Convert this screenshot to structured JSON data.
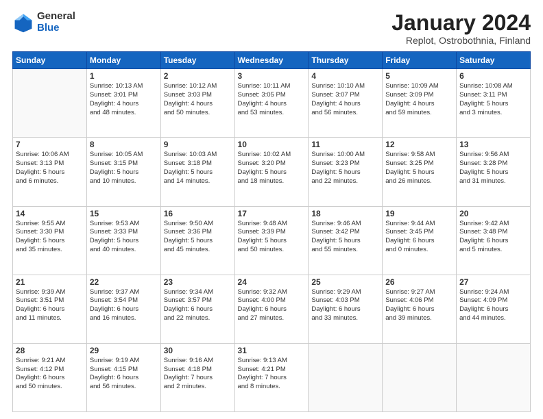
{
  "logo": {
    "general": "General",
    "blue": "Blue"
  },
  "title": "January 2024",
  "subtitle": "Replot, Ostrobothnia, Finland",
  "weekdays": [
    "Sunday",
    "Monday",
    "Tuesday",
    "Wednesday",
    "Thursday",
    "Friday",
    "Saturday"
  ],
  "weeks": [
    [
      {
        "day": "",
        "detail": ""
      },
      {
        "day": "1",
        "detail": "Sunrise: 10:13 AM\nSunset: 3:01 PM\nDaylight: 4 hours\nand 48 minutes."
      },
      {
        "day": "2",
        "detail": "Sunrise: 10:12 AM\nSunset: 3:03 PM\nDaylight: 4 hours\nand 50 minutes."
      },
      {
        "day": "3",
        "detail": "Sunrise: 10:11 AM\nSunset: 3:05 PM\nDaylight: 4 hours\nand 53 minutes."
      },
      {
        "day": "4",
        "detail": "Sunrise: 10:10 AM\nSunset: 3:07 PM\nDaylight: 4 hours\nand 56 minutes."
      },
      {
        "day": "5",
        "detail": "Sunrise: 10:09 AM\nSunset: 3:09 PM\nDaylight: 4 hours\nand 59 minutes."
      },
      {
        "day": "6",
        "detail": "Sunrise: 10:08 AM\nSunset: 3:11 PM\nDaylight: 5 hours\nand 3 minutes."
      }
    ],
    [
      {
        "day": "7",
        "detail": "Sunrise: 10:06 AM\nSunset: 3:13 PM\nDaylight: 5 hours\nand 6 minutes."
      },
      {
        "day": "8",
        "detail": "Sunrise: 10:05 AM\nSunset: 3:15 PM\nDaylight: 5 hours\nand 10 minutes."
      },
      {
        "day": "9",
        "detail": "Sunrise: 10:03 AM\nSunset: 3:18 PM\nDaylight: 5 hours\nand 14 minutes."
      },
      {
        "day": "10",
        "detail": "Sunrise: 10:02 AM\nSunset: 3:20 PM\nDaylight: 5 hours\nand 18 minutes."
      },
      {
        "day": "11",
        "detail": "Sunrise: 10:00 AM\nSunset: 3:23 PM\nDaylight: 5 hours\nand 22 minutes."
      },
      {
        "day": "12",
        "detail": "Sunrise: 9:58 AM\nSunset: 3:25 PM\nDaylight: 5 hours\nand 26 minutes."
      },
      {
        "day": "13",
        "detail": "Sunrise: 9:56 AM\nSunset: 3:28 PM\nDaylight: 5 hours\nand 31 minutes."
      }
    ],
    [
      {
        "day": "14",
        "detail": "Sunrise: 9:55 AM\nSunset: 3:30 PM\nDaylight: 5 hours\nand 35 minutes."
      },
      {
        "day": "15",
        "detail": "Sunrise: 9:53 AM\nSunset: 3:33 PM\nDaylight: 5 hours\nand 40 minutes."
      },
      {
        "day": "16",
        "detail": "Sunrise: 9:50 AM\nSunset: 3:36 PM\nDaylight: 5 hours\nand 45 minutes."
      },
      {
        "day": "17",
        "detail": "Sunrise: 9:48 AM\nSunset: 3:39 PM\nDaylight: 5 hours\nand 50 minutes."
      },
      {
        "day": "18",
        "detail": "Sunrise: 9:46 AM\nSunset: 3:42 PM\nDaylight: 5 hours\nand 55 minutes."
      },
      {
        "day": "19",
        "detail": "Sunrise: 9:44 AM\nSunset: 3:45 PM\nDaylight: 6 hours\nand 0 minutes."
      },
      {
        "day": "20",
        "detail": "Sunrise: 9:42 AM\nSunset: 3:48 PM\nDaylight: 6 hours\nand 5 minutes."
      }
    ],
    [
      {
        "day": "21",
        "detail": "Sunrise: 9:39 AM\nSunset: 3:51 PM\nDaylight: 6 hours\nand 11 minutes."
      },
      {
        "day": "22",
        "detail": "Sunrise: 9:37 AM\nSunset: 3:54 PM\nDaylight: 6 hours\nand 16 minutes."
      },
      {
        "day": "23",
        "detail": "Sunrise: 9:34 AM\nSunset: 3:57 PM\nDaylight: 6 hours\nand 22 minutes."
      },
      {
        "day": "24",
        "detail": "Sunrise: 9:32 AM\nSunset: 4:00 PM\nDaylight: 6 hours\nand 27 minutes."
      },
      {
        "day": "25",
        "detail": "Sunrise: 9:29 AM\nSunset: 4:03 PM\nDaylight: 6 hours\nand 33 minutes."
      },
      {
        "day": "26",
        "detail": "Sunrise: 9:27 AM\nSunset: 4:06 PM\nDaylight: 6 hours\nand 39 minutes."
      },
      {
        "day": "27",
        "detail": "Sunrise: 9:24 AM\nSunset: 4:09 PM\nDaylight: 6 hours\nand 44 minutes."
      }
    ],
    [
      {
        "day": "28",
        "detail": "Sunrise: 9:21 AM\nSunset: 4:12 PM\nDaylight: 6 hours\nand 50 minutes."
      },
      {
        "day": "29",
        "detail": "Sunrise: 9:19 AM\nSunset: 4:15 PM\nDaylight: 6 hours\nand 56 minutes."
      },
      {
        "day": "30",
        "detail": "Sunrise: 9:16 AM\nSunset: 4:18 PM\nDaylight: 7 hours\nand 2 minutes."
      },
      {
        "day": "31",
        "detail": "Sunrise: 9:13 AM\nSunset: 4:21 PM\nDaylight: 7 hours\nand 8 minutes."
      },
      {
        "day": "",
        "detail": ""
      },
      {
        "day": "",
        "detail": ""
      },
      {
        "day": "",
        "detail": ""
      }
    ]
  ]
}
